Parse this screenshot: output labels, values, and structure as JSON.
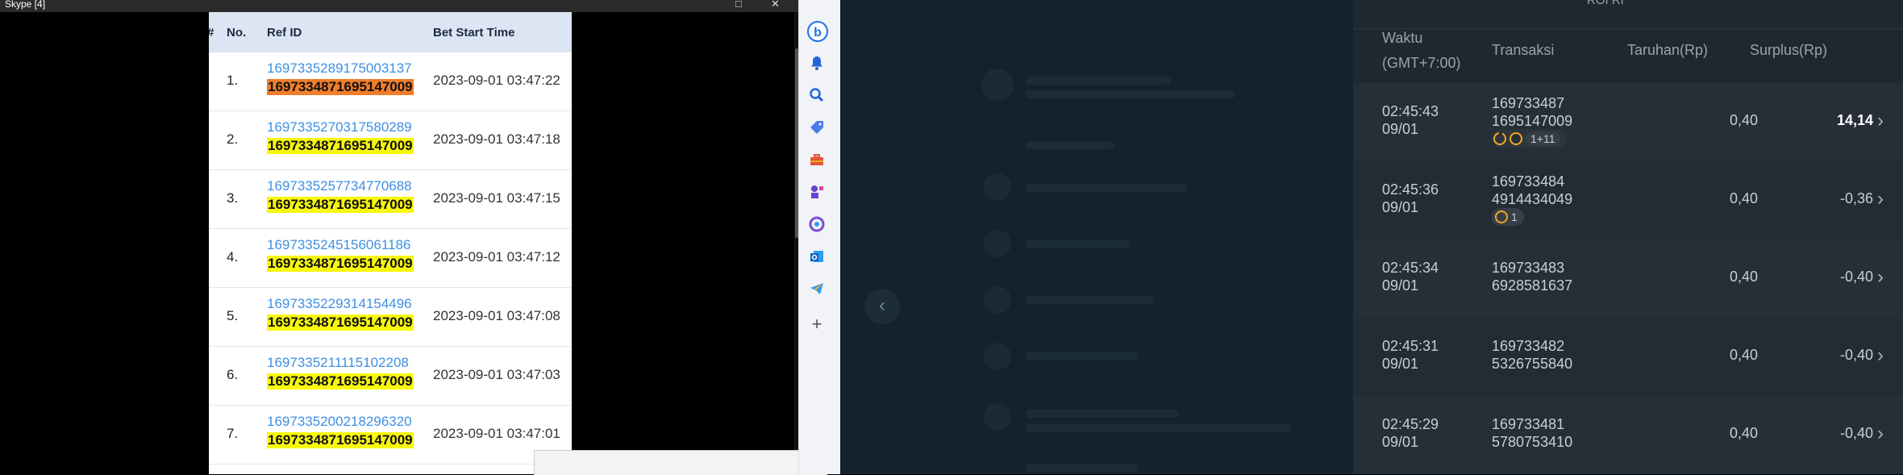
{
  "skype": {
    "title": "Skype [4]",
    "minimize": "□",
    "close": "✕",
    "columns": {
      "hash": "#",
      "no": "No.",
      "ref": "Ref ID",
      "time": "Bet Start Time"
    },
    "rows": [
      {
        "no": "1.",
        "ref": "1697335289175003137",
        "ref2": "1697334871695147009",
        "time": "2023-09-01 03:47:22",
        "highlight": "orange"
      },
      {
        "no": "2.",
        "ref": "1697335270317580289",
        "ref2": "1697334871695147009",
        "time": "2023-09-01 03:47:18",
        "highlight": "yellow"
      },
      {
        "no": "3.",
        "ref": "1697335257734770688",
        "ref2": "1697334871695147009",
        "time": "2023-09-01 03:47:15",
        "highlight": "yellow"
      },
      {
        "no": "4.",
        "ref": "1697335245156061186",
        "ref2": "1697334871695147009",
        "time": "2023-09-01 03:47:12",
        "highlight": "yellow"
      },
      {
        "no": "5.",
        "ref": "1697335229314154496",
        "ref2": "1697334871695147009",
        "time": "2023-09-01 03:47:08",
        "highlight": "yellow"
      },
      {
        "no": "6.",
        "ref": "1697335211115102208",
        "ref2": "1697334871695147009",
        "time": "2023-09-01 03:47:03",
        "highlight": "yellow"
      },
      {
        "no": "7.",
        "ref": "1697335200218296320",
        "ref2": "1697334871695147009",
        "time": "2023-09-01 03:47:01",
        "highlight": "yellow"
      }
    ]
  },
  "edge_sidebar": {
    "icons": [
      "bing-icon",
      "bell-icon",
      "search-icon",
      "tag-icon",
      "toolbox-icon",
      "games-icon",
      "office-icon",
      "outlook-icon",
      "telegram-icon",
      "add-icon"
    ],
    "add_glyph": "+"
  },
  "site": {
    "back_glyph": "‹",
    "top_label": "ROI RI",
    "columns": {
      "waktu": "Waktu",
      "gmt": "(GMT+7:00)",
      "transaksi": "Transaksi",
      "taruhan": "Taruhan(Rp)",
      "surplus": "Surplus(Rp)"
    },
    "rows": [
      {
        "time": "02:45:43",
        "date": "09/01",
        "id1": "169733487",
        "id2": "1695147009",
        "stake": "0,40",
        "surplus": "14,14",
        "badge": "1+11",
        "icons": 2
      },
      {
        "time": "02:45:36",
        "date": "09/01",
        "id1": "169733484",
        "id2": "4914434049",
        "stake": "0,40",
        "surplus": "-0,36",
        "badge": "1",
        "icons": 1
      },
      {
        "time": "02:45:34",
        "date": "09/01",
        "id1": "169733483",
        "id2": "6928581637",
        "stake": "0,40",
        "surplus": "-0,40"
      },
      {
        "time": "02:45:31",
        "date": "09/01",
        "id1": "169733482",
        "id2": "5326755840",
        "stake": "0,40",
        "surplus": "-0,40"
      },
      {
        "time": "02:45:29",
        "date": "09/01",
        "id1": "169733481",
        "id2": "5780753410",
        "stake": "0,40",
        "surplus": "-0,40"
      }
    ],
    "chevron": "›"
  }
}
